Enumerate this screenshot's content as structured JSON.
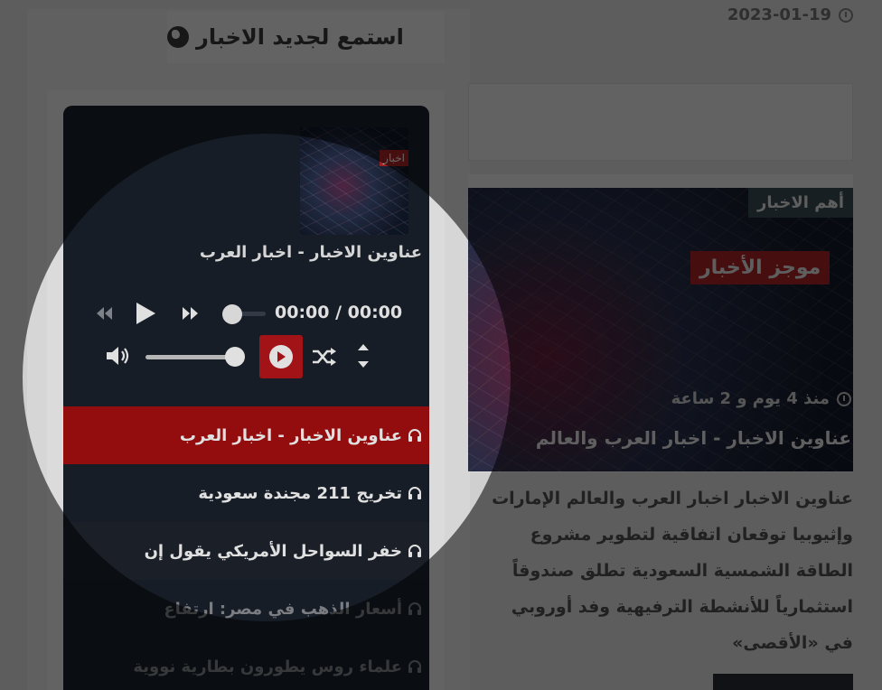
{
  "sidebar": {
    "widget_title": "استمع لجديد الاخبار"
  },
  "player": {
    "thumbnail_tag": "اخبار",
    "current_title": "عناوين الاخبار - اخبار العرب",
    "time_display": "00:00 / 00:00",
    "volume_level": 1.0,
    "playlist": [
      {
        "label": "عناوين الاخبار - اخبار العرب",
        "state": "active"
      },
      {
        "label": "تخريج 211 مجندة سعودية",
        "state": "normal"
      },
      {
        "label": "خفر السواحل الأمريكي يقول إن",
        "state": "normal"
      },
      {
        "label": "أسعار الذهب في مصر: ارتفاع",
        "state": "dim"
      },
      {
        "label": "علماء روس يطورون بطارية نووية",
        "state": "dim"
      }
    ]
  },
  "article": {
    "date": "2023-01-19",
    "category_tag": "أهم الاخبار",
    "brand_label": "موجز الأخبار",
    "time_ago": "منذ 4 يوم و 2 ساعة",
    "title": "عناوين الاخبار - اخبار العرب والعالم",
    "excerpt": "عناوين الاخبار اخبار العرب والعالم  الإمارات وإثيوبيا توقعان اتفاقية لتطوير مشروع الطاقة الشمسية  السعودية تطلق صندوقاً استثمارياً للأنشطة الترفيهية  وفد أوروبي في «الأقصى»"
  },
  "colors": {
    "player_bg": "#1b212c",
    "accent_red": "#a80f12",
    "tag_bg": "#3b5058"
  },
  "icons": [
    "globe-icon",
    "clock-icon",
    "rewind-icon",
    "play-icon",
    "fast-forward-icon",
    "volume-icon",
    "autoplay-icon",
    "shuffle-icon",
    "toggle-playlist-icon",
    "headphones-icon"
  ]
}
